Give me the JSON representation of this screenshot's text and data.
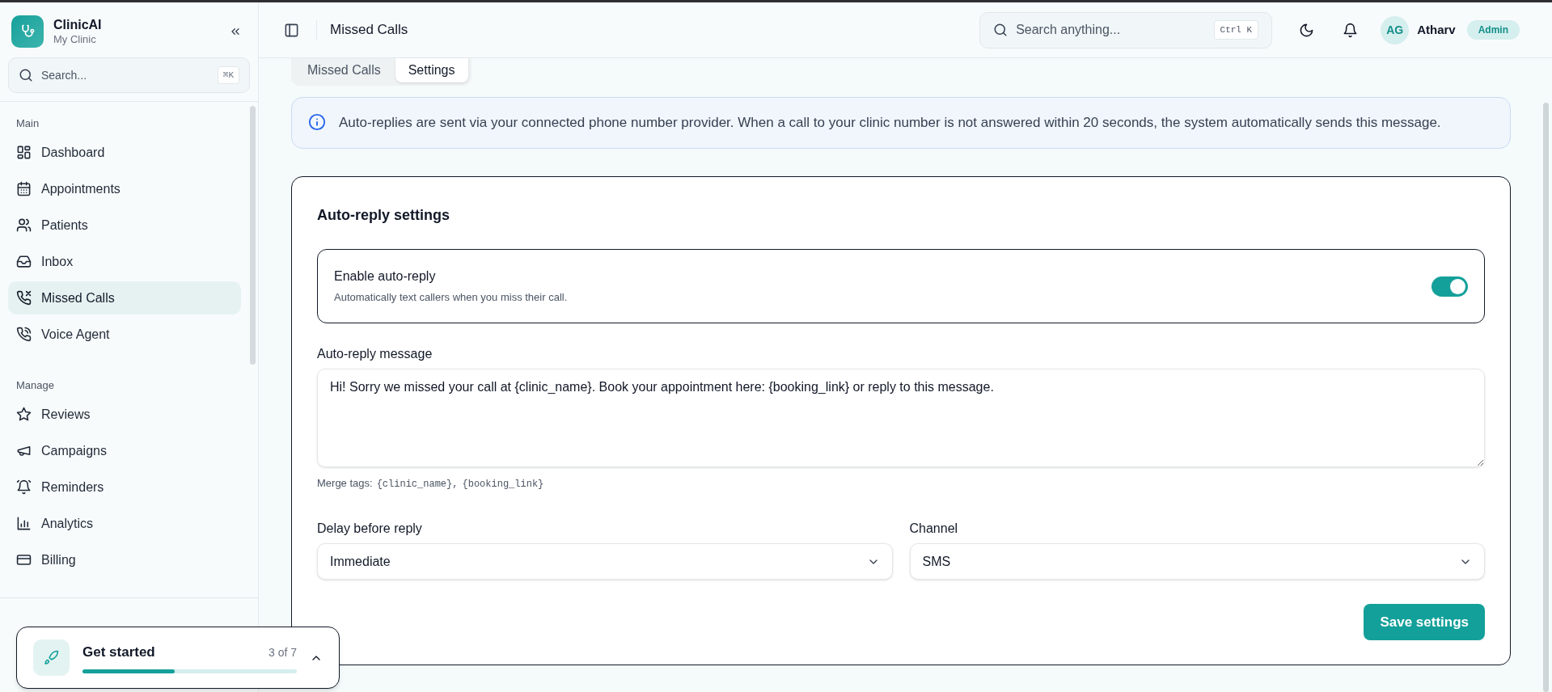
{
  "sidebar": {
    "brand": {
      "name": "ClinicAI",
      "subtitle": "My Clinic"
    },
    "search": {
      "placeholder": "Search...",
      "shortcut": "⌘K"
    },
    "sections": [
      {
        "title": "Main",
        "items": [
          {
            "label": "Dashboard",
            "selected": false
          },
          {
            "label": "Appointments",
            "selected": false
          },
          {
            "label": "Patients",
            "selected": false
          },
          {
            "label": "Inbox",
            "selected": false
          },
          {
            "label": "Missed Calls",
            "selected": true
          },
          {
            "label": "Voice Agent",
            "selected": false
          }
        ]
      },
      {
        "title": "Manage",
        "items": [
          {
            "label": "Reviews",
            "selected": false
          },
          {
            "label": "Campaigns",
            "selected": false
          },
          {
            "label": "Reminders",
            "selected": false
          },
          {
            "label": "Analytics",
            "selected": false
          },
          {
            "label": "Billing",
            "selected": false
          }
        ]
      }
    ]
  },
  "header": {
    "title": "Missed Calls",
    "search": {
      "placeholder": "Search anything...",
      "shortcut": "Ctrl K"
    },
    "user": {
      "initials": "AG",
      "name": "Atharv",
      "role": "Admin"
    }
  },
  "tabs": [
    {
      "label": "Missed Calls",
      "selected": false
    },
    {
      "label": "Settings",
      "selected": true
    }
  ],
  "info_banner": {
    "text": "Auto-replies are sent via your connected phone number provider. When a call to your clinic number is not answered within 20 seconds, the system automatically sends this message."
  },
  "settings_card": {
    "title": "Auto-reply settings",
    "toggle": {
      "label": "Enable auto-reply",
      "description": "Automatically text callers when you miss their call.",
      "on": true
    },
    "message": {
      "label": "Auto-reply message",
      "value": "Hi! Sorry we missed your call at {clinic_name}. Book your appointment here: {booking_link} or reply to this message.",
      "hint_label": "Merge tags:",
      "merge_tags": [
        "{clinic_name},",
        "{booking_link}"
      ]
    },
    "selects": [
      {
        "label": "Delay before reply",
        "value": "Immediate"
      },
      {
        "label": "Channel",
        "value": "SMS"
      }
    ],
    "save_button": "Save settings"
  },
  "get_started": {
    "title": "Get started",
    "progress_text": "3 of 7",
    "level": 0.43
  }
}
